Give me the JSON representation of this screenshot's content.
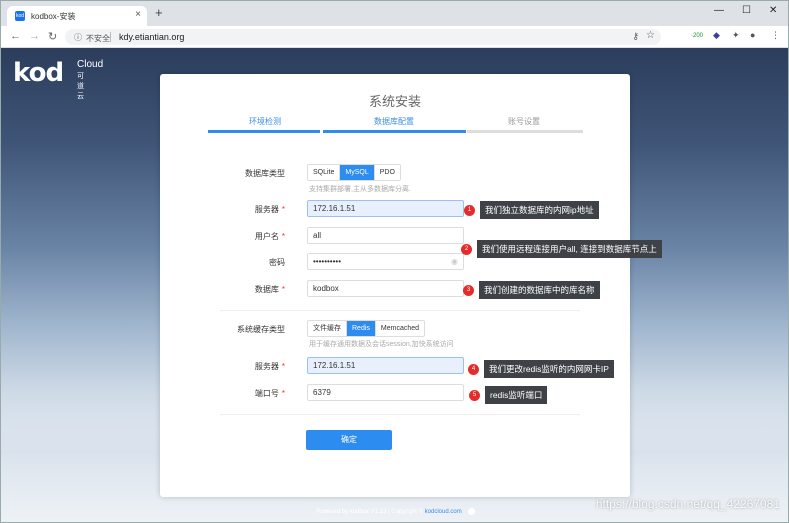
{
  "browser": {
    "tab_title": "kodbox-安装",
    "tab_favicon": "kod",
    "new_tab": "+",
    "window_controls": [
      "—",
      "☐",
      "✕"
    ],
    "insecure_label": "不安全",
    "url": "kdy.etiantian.org",
    "ext_badge": "·200"
  },
  "logo": {
    "text": "kod",
    "cloud": "Cloud",
    "cn": "可道云"
  },
  "card": {
    "title": "系统安装",
    "steps": [
      "环境检测",
      "数据库配置",
      "账号设置"
    ]
  },
  "db": {
    "type_label": "数据库类型",
    "types": [
      "SQLite",
      "MySQL",
      "PDO"
    ],
    "hint": "支持集群部署,主从多数据库分离.",
    "server_label": "服务器",
    "server_value": "172.16.1.51",
    "user_label": "用户名",
    "user_value": "all",
    "pass_label": "密码",
    "pass_value": "••••••••••",
    "name_label": "数据库",
    "name_value": "kodbox"
  },
  "cache": {
    "type_label": "系统缓存类型",
    "types": [
      "文件缓存",
      "Redis",
      "Memcached"
    ],
    "hint": "用于缓存通用数据及会话session,加快系统访问",
    "server_label": "服务器",
    "server_value": "172.16.1.51",
    "port_label": "端口号",
    "port_value": "6379"
  },
  "submit_label": "确定",
  "footer": {
    "text": "Powered by kodbox V1.13  |  Copyright © ",
    "link": "kodcloud.com"
  },
  "annotations": [
    {
      "num": "1",
      "text": "我们独立数据库的内网ip地址"
    },
    {
      "num": "2",
      "text": "我们使用远程连接用户all, 连接到数据库节点上"
    },
    {
      "num": "3",
      "text": "我们创建的数据库中的库名称"
    },
    {
      "num": "4",
      "text": "我们更改redis监听的内网网卡IP"
    },
    {
      "num": "5",
      "text": "redis监听端口"
    }
  ],
  "watermark": "https://blog.csdn.net/qq_42267081"
}
